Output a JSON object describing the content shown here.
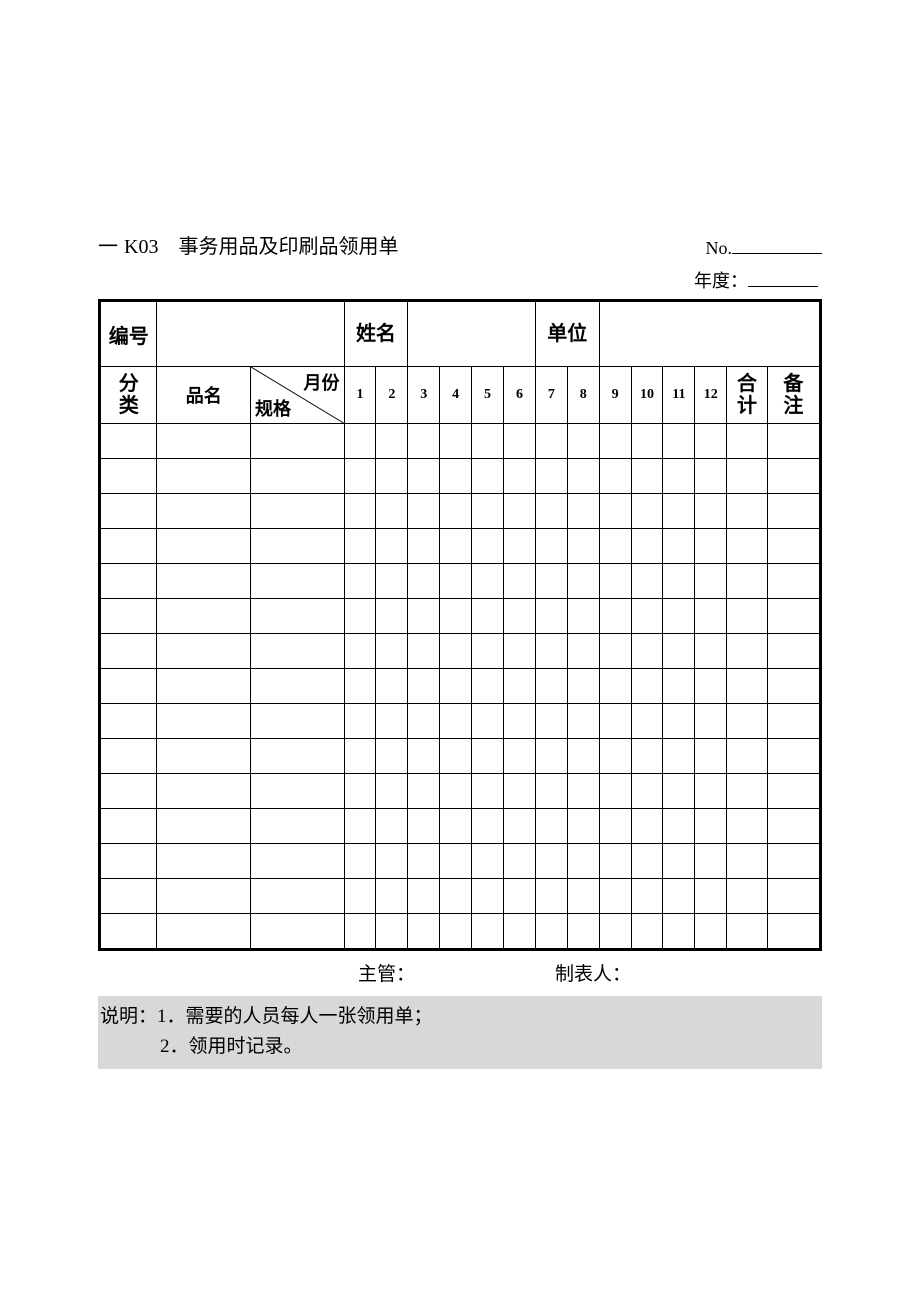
{
  "header": {
    "dash": "一",
    "code": "K03",
    "title": "事务用品及印刷品领用单",
    "no_label": "No.",
    "year_label": "年度："
  },
  "table": {
    "row1": {
      "c_bianhao": "编号",
      "c_xingming": "姓名",
      "c_danwei": "单位"
    },
    "row2": {
      "fenlei_l1": "分",
      "fenlei_l2": "类",
      "pinming": "品名",
      "diag_tr": "月份",
      "diag_bl": "规格",
      "m1": "1",
      "m2": "2",
      "m3": "3",
      "m4": "4",
      "m5": "5",
      "m6": "6",
      "m7": "7",
      "m8": "8",
      "m9": "9",
      "m10": "10",
      "m11": "11",
      "m12": "12",
      "heji_l1": "合",
      "heji_l2": "计",
      "beizhu_l1": "备",
      "beizhu_l2": "注"
    },
    "blank_rows": 15
  },
  "signatures": {
    "supervisor": "主管：",
    "preparer": "制表人："
  },
  "notes": {
    "line1": "说明：1．需要的人员每人一张领用单；",
    "line2": "2．领用时记录。"
  }
}
